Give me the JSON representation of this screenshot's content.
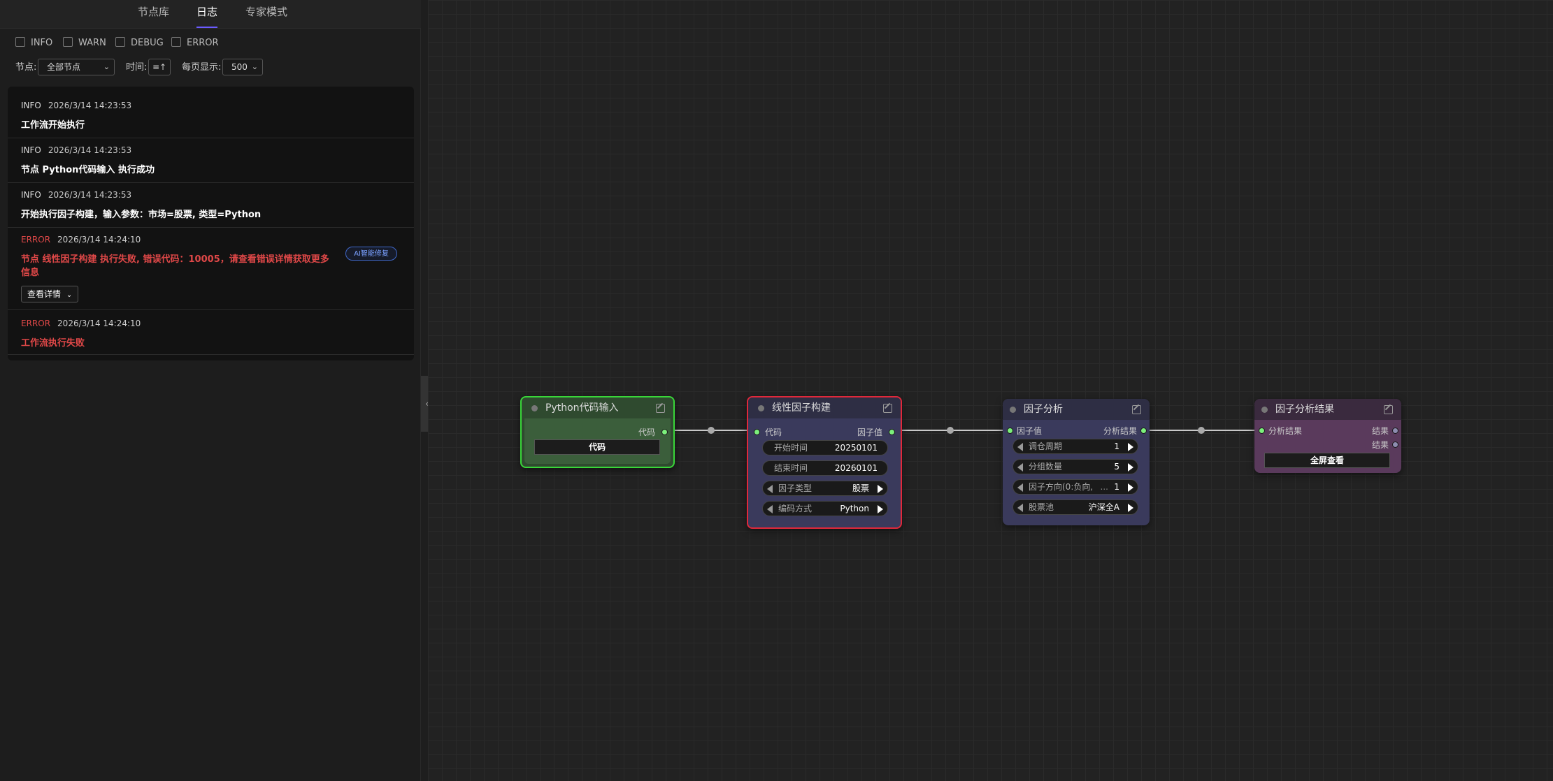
{
  "tabs": [
    {
      "label": "节点库",
      "active": false
    },
    {
      "label": "日志",
      "active": true
    },
    {
      "label": "专家模式",
      "active": false
    }
  ],
  "filters": {
    "levels": [
      {
        "label": "INFO",
        "checked": false
      },
      {
        "label": "WARN",
        "checked": false
      },
      {
        "label": "DEBUG",
        "checked": false
      },
      {
        "label": "ERROR",
        "checked": false
      }
    ]
  },
  "controls": {
    "node_label": "节点:",
    "node_value": "全部节点",
    "time_label": "时间:",
    "page_size_label": "每页显示:",
    "page_size_value": "500"
  },
  "logs": [
    {
      "level": "INFO",
      "time": "2026/3/14 14:23:53",
      "message": "工作流开始执行"
    },
    {
      "level": "INFO",
      "time": "2026/3/14 14:23:53",
      "message": "节点 Python代码输入 执行成功"
    },
    {
      "level": "INFO",
      "time": "2026/3/14 14:23:53",
      "message": "开始执行因子构建，输入参数：市场=股票, 类型=Python"
    },
    {
      "level": "ERROR",
      "time": "2026/3/14 14:24:10",
      "message_line1": "节点 线性因子构建 执行失败, 错误代码：10005，请查看错误详情获取更多",
      "message_line2": "信息",
      "ai_button": "AI智能修复",
      "detail_button": "查看详情"
    },
    {
      "level": "ERROR",
      "time": "2026/3/14 14:24:10",
      "message": "工作流执行失败"
    }
  ],
  "nodes": {
    "python_input": {
      "title": "Python代码输入",
      "output": "代码",
      "button": "代码",
      "border": "#39d639",
      "bg": "#2f4a2f"
    },
    "linear_factor": {
      "title": "线性因子构建",
      "input": "代码",
      "output": "因子值",
      "border": "#e0283a",
      "bg": "#3a3a5c",
      "widgets": [
        {
          "label": "开始时间",
          "value": "20250101"
        },
        {
          "label": "结束时间",
          "value": "20260101"
        },
        {
          "label": "因子类型",
          "value": "股票"
        },
        {
          "label": "编码方式",
          "value": "Python"
        }
      ]
    },
    "factor_analysis": {
      "title": "因子分析",
      "input": "因子值",
      "output": "分析结果",
      "bg": "#3a3a5c",
      "widgets": [
        {
          "label": "调仓周期",
          "value": "1"
        },
        {
          "label": "分组数量",
          "value": "5"
        },
        {
          "label": "因子方向(0:负向,",
          "ellipsis": "...",
          "value": "1"
        },
        {
          "label": "股票池",
          "value": "沪深全A"
        }
      ]
    },
    "factor_result": {
      "title": "因子分析结果",
      "input": "分析结果",
      "outputs": [
        "结果",
        "结果"
      ],
      "button": "全屏查看",
      "bg": "#5a3a5c"
    }
  }
}
